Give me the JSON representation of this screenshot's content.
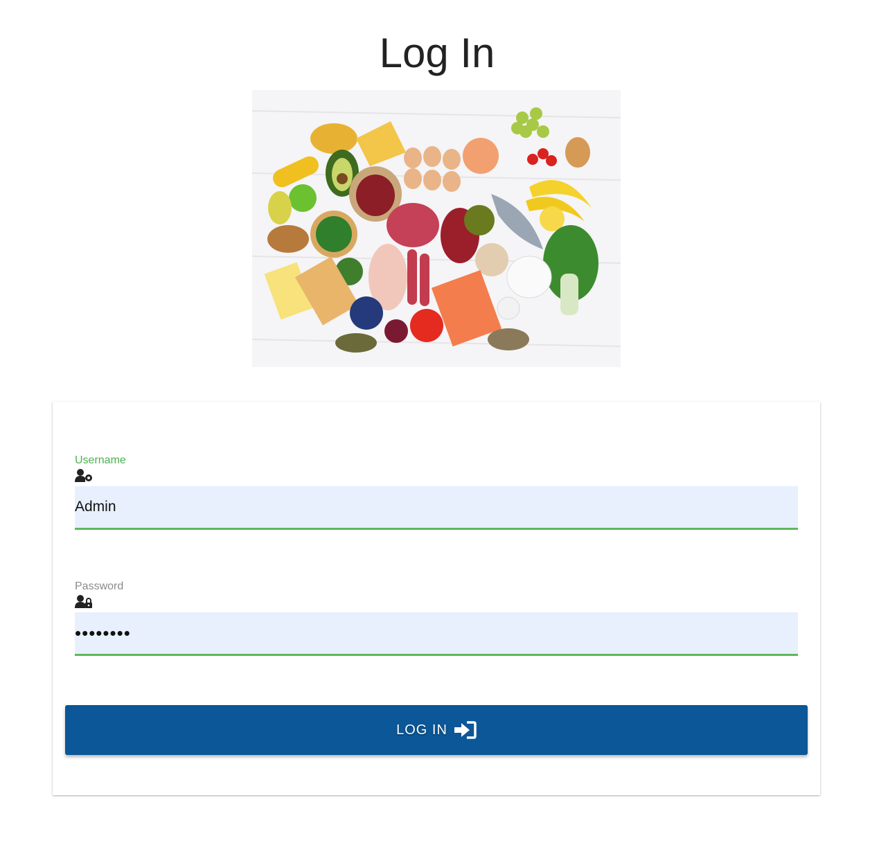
{
  "page": {
    "title": "Log In"
  },
  "hero": {
    "image_subject": "assorted healthy foods"
  },
  "form": {
    "username": {
      "label": "Username",
      "value": "Admin",
      "icon": "user-gear-icon"
    },
    "password": {
      "label": "Password",
      "value": "••••••••",
      "icon": "user-lock-icon"
    },
    "submit": {
      "label": "LOG IN",
      "icon": "sign-in-icon"
    }
  },
  "colors": {
    "active_label": "#4caf50",
    "input_bg": "#e8f0fe",
    "underline": "#5cb85c",
    "button": "#0b5797"
  }
}
